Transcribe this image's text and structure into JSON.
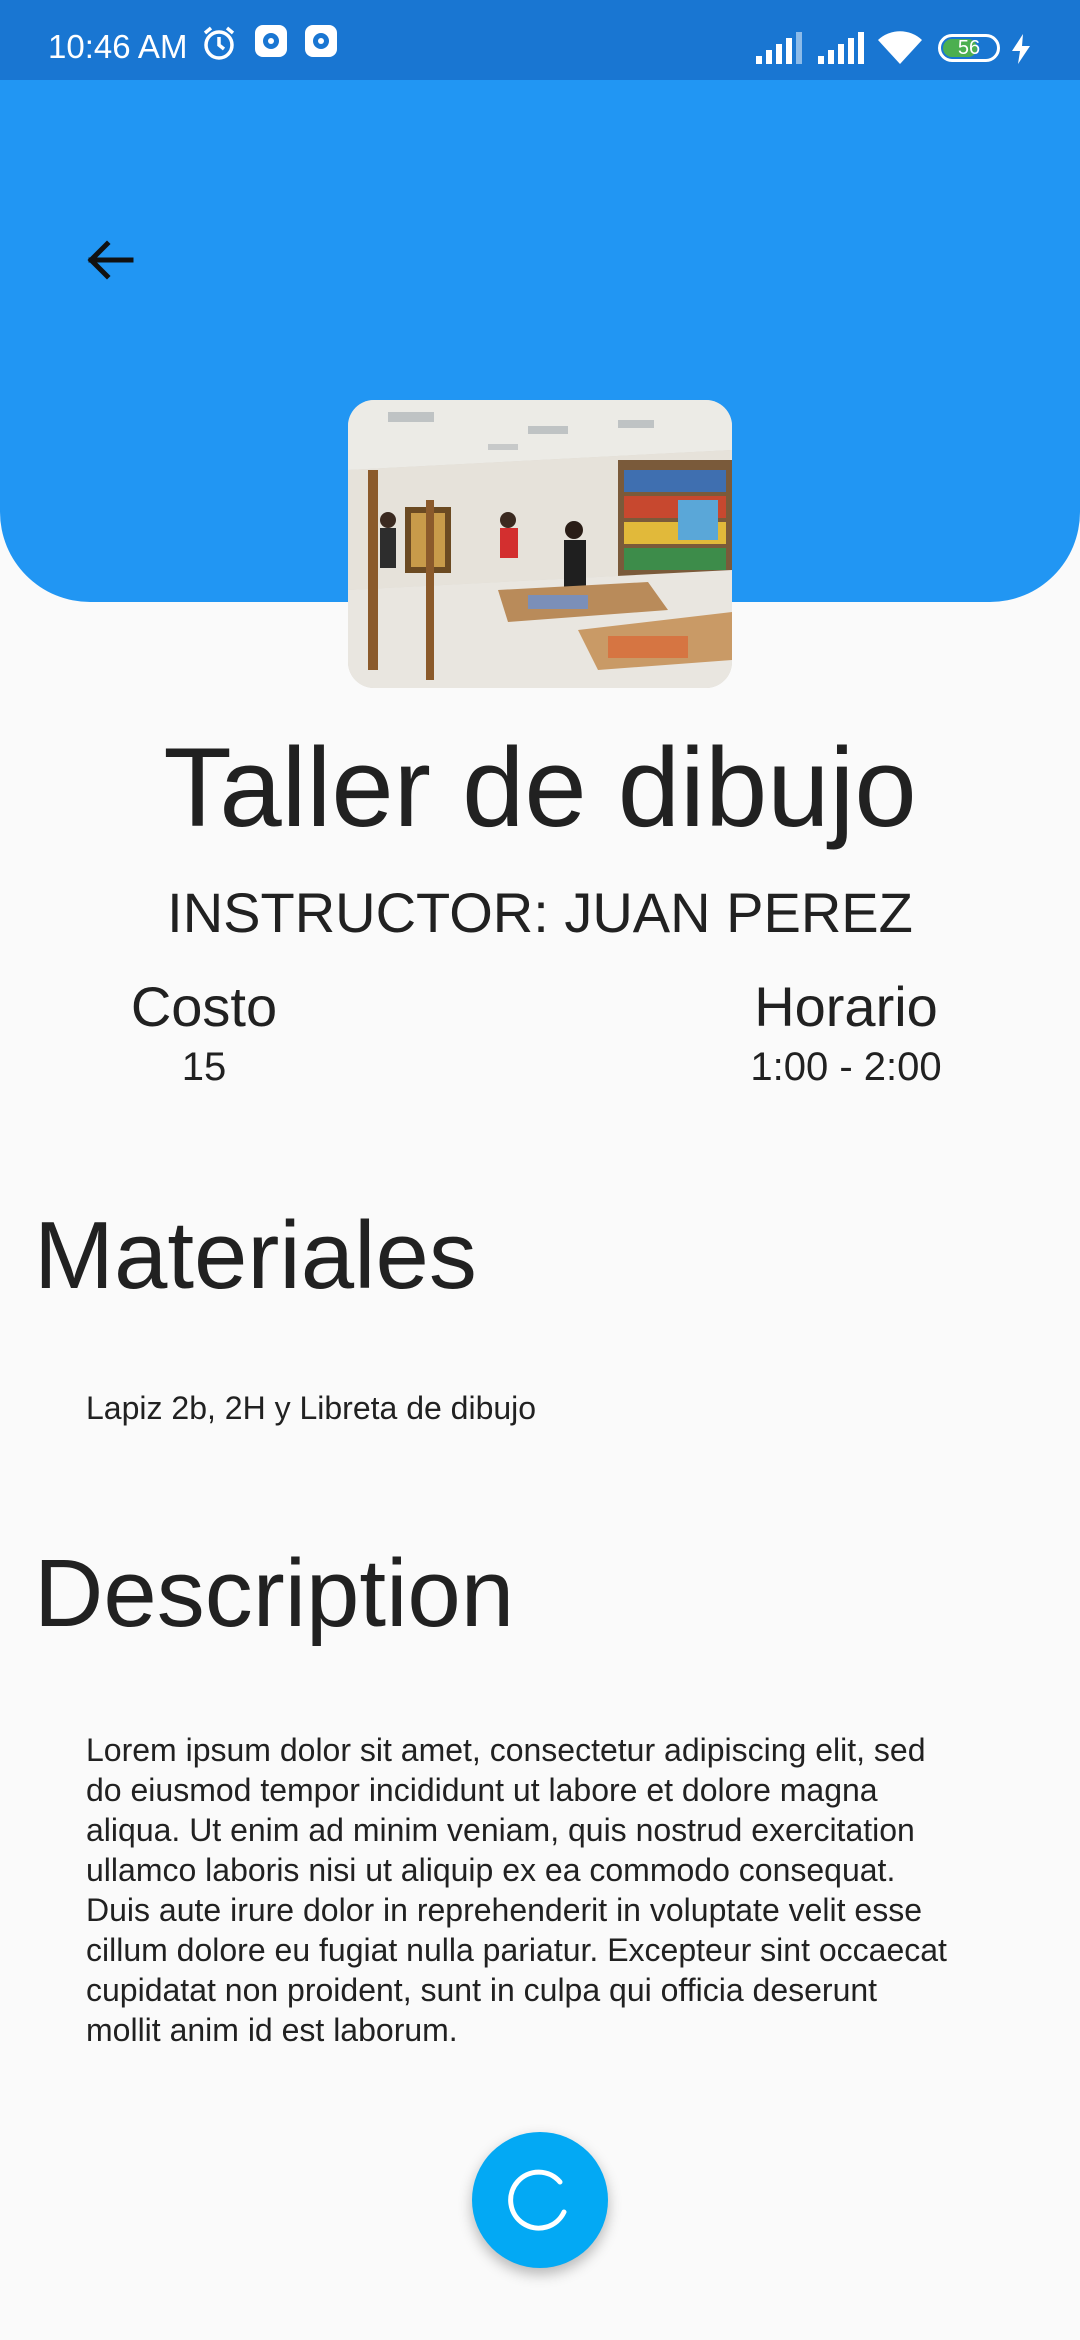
{
  "status_bar": {
    "time": "10:46 AM",
    "battery": "56",
    "icons": [
      "alarm-icon",
      "settings-notification-icon",
      "settings-notification-icon",
      "signal-icon",
      "signal-icon",
      "wifi-icon",
      "battery-icon",
      "charging-icon"
    ]
  },
  "colors": {
    "app_bar": "#2196f3",
    "status_bar": "#1976d2",
    "fab": "#03a9f4",
    "background": "#fafafa"
  },
  "header": {
    "back_icon": "arrow-back-icon",
    "image": "art-workshop-photo"
  },
  "course": {
    "title": "Taller de dibujo",
    "instructor": "INSTRUCTOR: JUAN PEREZ",
    "cost_label": "Costo",
    "cost_value": "15",
    "schedule_label": "Horario",
    "schedule_value": "1:00 - 2:00"
  },
  "materials": {
    "heading": "Materiales",
    "text": "Lapiz 2b, 2H y Libreta de dibujo"
  },
  "description": {
    "heading": "Description",
    "lines": [
      "Lorem ipsum dolor sit amet, consectetur adipiscing elit, sed",
      "do eiusmod tempor incididunt ut labore et dolore magna",
      "aliqua. Ut enim ad minim veniam, quis nostrud exercitation",
      "ullamco laboris nisi ut aliquip ex ea commodo consequat.",
      "Duis aute irure dolor in reprehenderit in voluptate velit esse",
      "cillum dolore eu fugiat nulla pariatur. Excepteur sint occaecat",
      "cupidatat non proident, sunt in culpa qui officia deserunt",
      "mollit anim id est laborum."
    ]
  },
  "fab": {
    "icon": "refresh-icon"
  }
}
